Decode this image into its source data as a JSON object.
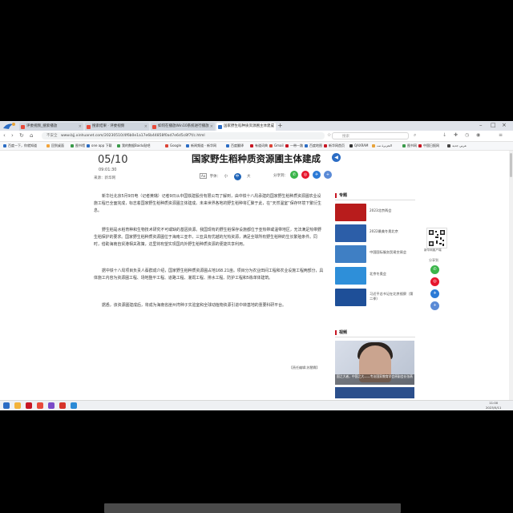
{
  "browser": {
    "tabs": [
      {
        "label": "评委视频_搜索播放",
        "color": "#e84a3a",
        "active": false
      },
      {
        "label": "搜索结果 · 评委视频",
        "color": "#e84a3a",
        "active": false
      },
      {
        "label": "如何在播放Win10系统进行播放",
        "color": "#e84a3a",
        "active": false
      },
      {
        "label": "国家野生稻种质资源圃主体建成",
        "color": "#2b6cc4",
        "active": true
      }
    ],
    "url_security": "不安全",
    "url": "www.bjj.xinhuanet.com/20230510/4f6b0e1a17e6b44858f0ad7e6d5c8f7f/c.html",
    "search_placeholder": "搜索",
    "bookmarks": [
      "百度一下，你就知道",
      "回到桌面",
      "图书馆",
      "one app 下载",
      "我的数据Baidu贴吧",
      "Google",
      "新闻频道 - 新华网",
      "百度翻译",
      "有道词典",
      "Gmail",
      "一带一路",
      "百度地图",
      "新华网首页",
      "QAXRAM",
      "الجزيرة نت",
      "图书网",
      "中国日报网",
      "عربي جديد"
    ],
    "taskbar_clock_time": "11:00",
    "taskbar_clock_date": "2023/5/11"
  },
  "article": {
    "date": "05/10",
    "time": "09:01:30",
    "source": "来源：新华网",
    "title": "国家野生稻种质资源圃主体建成",
    "font_label": "字体：",
    "font_sizes": [
      "小",
      "中",
      "大"
    ],
    "share_label": "分享到：",
    "paragraphs": [
      "新华社北京5月9日电（记者黄璐）记者9日从中国铁建股份有限公司了解到，由中铁十八局承建的国家野生稻种质资源圃农业设施工程已全面完成，标志着国家野生稻种质资源圃主体建成。未来世界各地的野生稻种将汇聚于此，在“天然温室”保存环境下繁衍生息。",
      "野生稻是水稻育种和生物技术研究不可或缺的基因资源。我国现有的野生稻保存设施都位于亚热带或温带地区，无法满足热带野生稻保护的要求。国家野生稻种质资源圃位于海南三亚市，三亚具有优越的光热资源，满足全球所有野生稻种的生长繁殖条件。同时，借助海南自贸港相关政策，这里将有望实现国内外野生稻种质资源的便捷共享利用。",
      "据中铁十八局项目负责人蔡群成介绍，国家野生稻种质资源圃占地168.21亩。项目分为农业田间工程和农业设施工程两部分，具体施工内容为资源圃工程、场地整平工程、道路工程、灌溉工程、排水工程、防护工程和5栋单体建筑。",
      "据悉，该资源圃建成后，将成为海南省崖州湾种子实验室和全球动植物资源引进中转基地的重要科研平台。"
    ],
    "editor": "【责任编辑:苏慧霖】"
  },
  "sidebar": {
    "topic_heading": "专题",
    "topics": [
      {
        "caption": "2023北京两会",
        "color": "#b81c1c"
      },
      {
        "caption": "2022最美冬奥北京",
        "color": "#2c5ea8"
      },
      {
        "caption": "中国国际服务贸易交易会",
        "color": "#3f7fc4"
      },
      {
        "caption": "北京冬奥会",
        "color": "#2e8fd9"
      },
      {
        "caption": "习近平总书记在北京视察（第二季）",
        "color": "#1e4f98"
      }
    ],
    "qr_caption": "新华网客户端",
    "share_to": "分享到",
    "video_heading": "视频",
    "video_caption": "国之大者，中国之大——专访国家教育学会原副会长张燕"
  },
  "colors": {
    "accent_blue": "#1e64b8",
    "accent_red": "#c81623"
  }
}
